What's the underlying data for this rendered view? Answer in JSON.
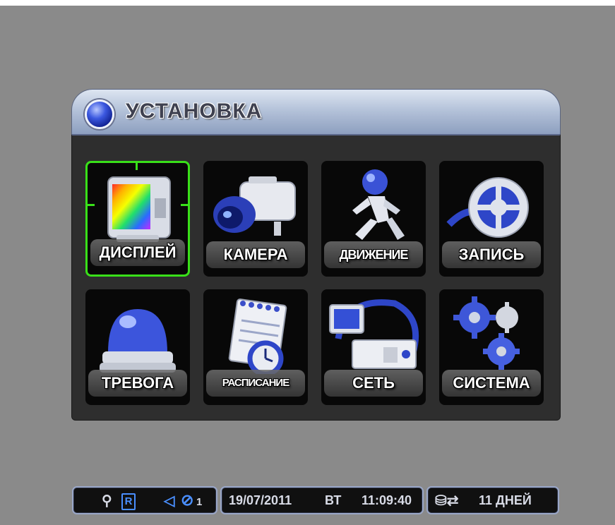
{
  "window": {
    "title": "УСТАНОВКА"
  },
  "menu": {
    "items": [
      {
        "label": "ДИСПЛЕЙ",
        "icon": "display-monitor-icon",
        "selected": true
      },
      {
        "label": "КАМЕРА",
        "icon": "camera-icon",
        "selected": false
      },
      {
        "label": "ДВИЖЕНИЕ",
        "icon": "motion-runner-icon",
        "selected": false
      },
      {
        "label": "ЗАПИСЬ",
        "icon": "film-reel-icon",
        "selected": false
      },
      {
        "label": "ТРЕВОГА",
        "icon": "alarm-siren-icon",
        "selected": false
      },
      {
        "label": "РАСПИСАНИЕ",
        "icon": "schedule-notepad-clock-icon",
        "selected": false
      },
      {
        "label": "СЕТЬ",
        "icon": "network-computer-icon",
        "selected": false
      },
      {
        "label": "СИСТЕМА",
        "icon": "system-gears-icon",
        "selected": false
      }
    ]
  },
  "status_bar": {
    "usb_icon": "usb-icon",
    "record_badge": "R",
    "audio_icon": "speaker-icon",
    "audio_channel": "1",
    "date": "19/07/2011",
    "weekday": "ВТ",
    "time": "11:09:40",
    "storage_icon": "hdd-overwrite-icon",
    "days_left": "11 ДНЕЙ"
  },
  "colors": {
    "selection": "#39e019",
    "background": "#8a8a8a",
    "panel": "#2e2e2e",
    "title_bar": "#b5c3da",
    "status_accent": "#4a8fff"
  }
}
